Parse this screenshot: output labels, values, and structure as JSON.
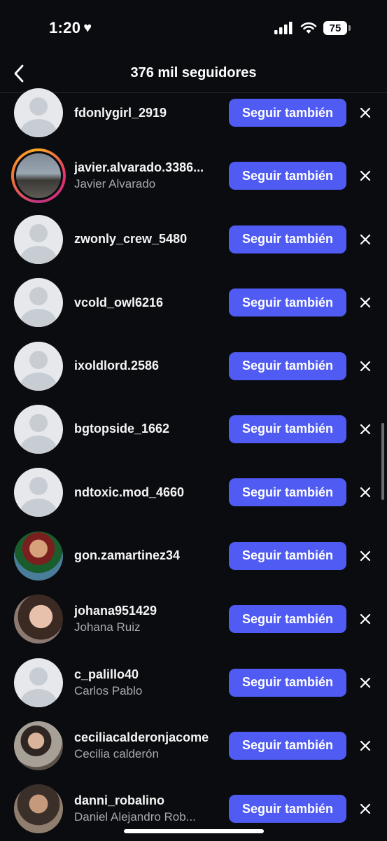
{
  "status": {
    "time": "1:20",
    "heart": "♥",
    "battery": "75"
  },
  "header": {
    "title": "376 mil seguidores"
  },
  "follow_label": "Seguir también",
  "followers": [
    {
      "username": "fdonlygirl_2919",
      "fullname": "",
      "avatar": "default"
    },
    {
      "username": "javier.alvarado.3386...",
      "fullname": "Javier Alvarado",
      "avatar": "story"
    },
    {
      "username": "zwonly_crew_5480",
      "fullname": "",
      "avatar": "default"
    },
    {
      "username": "vcold_owl6216",
      "fullname": "",
      "avatar": "default"
    },
    {
      "username": "ixoldlord.2586",
      "fullname": "",
      "avatar": "default"
    },
    {
      "username": "bgtopside_1662",
      "fullname": "",
      "avatar": "default"
    },
    {
      "username": "ndtoxic.mod_4660",
      "fullname": "",
      "avatar": "default"
    },
    {
      "username": "gon.zamartinez34",
      "fullname": "",
      "avatar": "photo1"
    },
    {
      "username": "johana951429",
      "fullname": "Johana Ruiz",
      "avatar": "photo2"
    },
    {
      "username": "c_palillo40",
      "fullname": "Carlos Pablo",
      "avatar": "default"
    },
    {
      "username": "ceciliacalderonjacome",
      "fullname": "Cecilia calderón",
      "avatar": "photo3"
    },
    {
      "username": "danni_robalino",
      "fullname": "Daniel Alejandro Rob...",
      "avatar": "photo4"
    }
  ],
  "colors": {
    "accent": "#4f5bf3",
    "background": "#0b0c10",
    "secondary_text": "#a8a9ad"
  },
  "icons": {
    "back": "chevron-left-icon",
    "remove": "close-icon"
  }
}
